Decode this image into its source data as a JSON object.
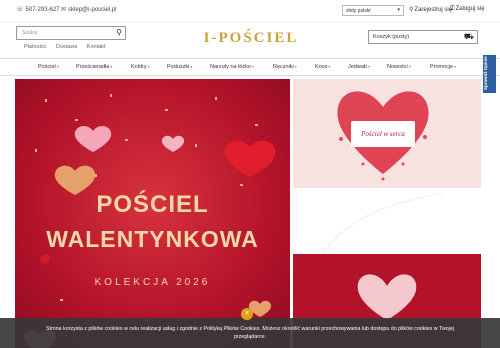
{
  "topbar": {
    "phone": "507-293-627",
    "email": "sklep@i-posciel.pl",
    "currency": "złoty polski",
    "register": "Zarejestruj się",
    "login": "Zaloguj się"
  },
  "search": {
    "placeholder": "Szukaj"
  },
  "sublinks": [
    "Płatności",
    "Dostawa",
    "Kontakt"
  ],
  "logo": "I-POŚCIEL",
  "cart": {
    "label": "Koszyk (pusty)"
  },
  "nav": [
    "Pościel",
    "Prześcieradła",
    "Koldry",
    "Poduszki",
    "Narzuty na łóżko",
    "Ręczniki",
    "Koce",
    "Jedwab",
    "Nowości",
    "Promocje"
  ],
  "side_tab": "Sprawdź Opinie",
  "hero": {
    "line1": "POŚCIEL",
    "line2": "WALENTYNKOWA",
    "subtitle": "KOLEKCJA 2026"
  },
  "panel1": {
    "label": "Pościel w serca"
  },
  "cookie": {
    "text_line1": "Strona korzysta z plików cookies w celu realizacji usług i zgodnie z Polityką Plików Cookies. Możesz określić warunki przechowywania lub dostępu do plików cookies w Twojej",
    "text_line2": "przeglądarce.",
    "close": "×"
  },
  "colors": {
    "accent_gold": "#c9a23b",
    "hero_red": "#b3132a",
    "side_tab_blue": "#2d5fa0",
    "cookie_close": "#e4a11b"
  }
}
